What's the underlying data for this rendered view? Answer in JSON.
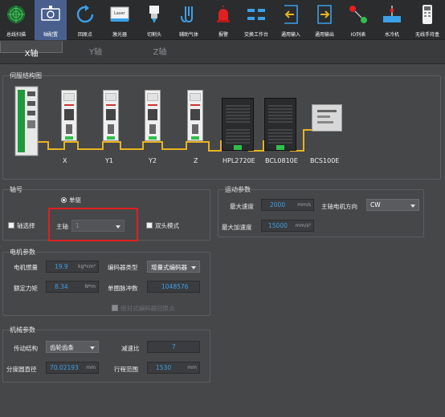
{
  "toolbar": {
    "items": [
      {
        "label": "总线扫描",
        "icon": "radar-icon"
      },
      {
        "label": "轴配置",
        "icon": "axis-config-icon"
      },
      {
        "label": "回原点",
        "icon": "home-icon"
      },
      {
        "label": "激光器",
        "icon": "laser-icon",
        "badge": "Laser"
      },
      {
        "label": "切割头",
        "icon": "cutting-head-icon"
      },
      {
        "label": "辅助气体",
        "icon": "gas-icon"
      },
      {
        "label": "报警",
        "icon": "alarm-icon"
      },
      {
        "label": "交换工作台",
        "icon": "exchange-table-icon"
      },
      {
        "label": "通用输入",
        "icon": "input-icon"
      },
      {
        "label": "通用输出",
        "icon": "output-icon"
      },
      {
        "label": "IO列表",
        "icon": "io-list-icon"
      },
      {
        "label": "水冷机",
        "icon": "water-cooler-icon"
      },
      {
        "label": "无线手持盒",
        "icon": "wireless-handheld-icon"
      }
    ],
    "active_index": 1
  },
  "tabs": [
    {
      "label": "X轴",
      "selected": true
    },
    {
      "label": "Y轴",
      "selected": false
    },
    {
      "label": "Z轴",
      "selected": false
    }
  ],
  "servo": {
    "title": "伺服结构图",
    "devices": [
      "X",
      "Y1",
      "Y2",
      "Z",
      "HPL2720E",
      "BCL0810E",
      "BCS100E"
    ]
  },
  "axis": {
    "title": "轴号",
    "radio_label": "单驱",
    "axis_select_label": "轴选择",
    "main_axis_label": "主轴",
    "main_axis_value": "1",
    "dual_head_label": "双头模式"
  },
  "motion": {
    "title": "运动参数",
    "max_speed_label": "最大速度",
    "max_speed_value": "2000",
    "max_speed_unit": "mm/s",
    "direction_label": "主轴电机方向",
    "direction_value": "CW",
    "max_accel_label": "最大加速度",
    "max_accel_value": "15000",
    "max_accel_unit": "mm/s²"
  },
  "motor": {
    "title": "电机参数",
    "inertia_label": "电机惯量",
    "inertia_value": "19.9",
    "inertia_unit": "kg*cm²",
    "encoder_type_label": "编码器类型",
    "encoder_type_value": "增量式编码器",
    "torque_label": "额定力矩",
    "torque_value": "8.34",
    "torque_unit": "N*m",
    "pulses_label": "单圈脉冲数",
    "pulses_value": "1048576",
    "abs_encoder_label": "绝对式编码器回原点"
  },
  "mech": {
    "title": "机械参数",
    "transmission_label": "传动结构",
    "transmission_value": "齿轮齿条",
    "ratio_label": "减速比",
    "ratio_value": "7",
    "pitch_dia_label": "分度圆直径",
    "pitch_dia_value": "70.02193",
    "pitch_dia_unit": "mm",
    "travel_label": "行程范围",
    "travel_value": "1530",
    "travel_unit": "mm"
  },
  "colors": {
    "accent_blue": "#3ba0e8",
    "highlight_red": "#e02020",
    "wire_yellow": "#e8b320",
    "active_toolbar": "#49608e"
  }
}
